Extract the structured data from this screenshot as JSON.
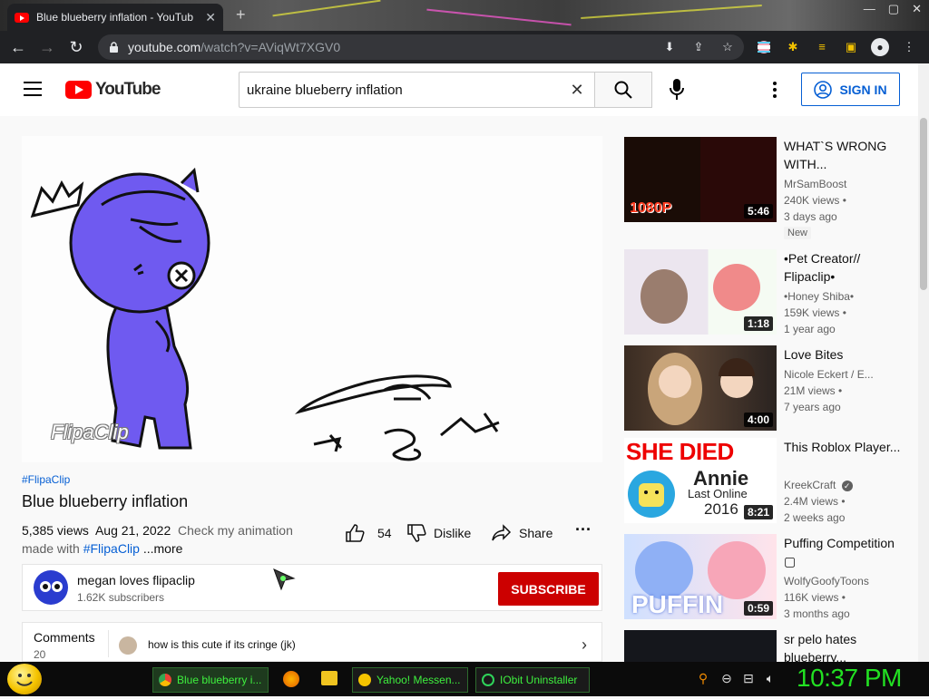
{
  "browser": {
    "tab_title": "Blue blueberry inflation - YouTub",
    "url_host": "youtube.com",
    "url_path": "/watch?v=AViqWt7XGV0"
  },
  "youtube": {
    "logo_text": "YouTube",
    "search_query": "ukraine blueberry inflation",
    "sign_in": "SIGN IN"
  },
  "video": {
    "hashtag": "#FlipaClip",
    "title": "Blue blueberry inflation",
    "views": "5,385 views",
    "date": "Aug 21, 2022",
    "description": "Check my animation",
    "desc_prefix": "made with",
    "desc_link": "#FlipaClip",
    "more": "...more",
    "likes": "54",
    "dislike": "Dislike",
    "share": "Share",
    "watermark": "FlipaClip"
  },
  "channel": {
    "name": "megan loves flipaclip",
    "subscribers": "1.62K subscribers",
    "subscribe": "SUBSCRIBE"
  },
  "comments": {
    "title": "Comments",
    "count": "20",
    "first": "how is this cute if its cringe (jk)"
  },
  "recommendations": [
    {
      "title": "WHAT`S WRONG WITH...",
      "channel": "MrSamBoost",
      "views": "240K views •",
      "age": "3 days ago",
      "badge": "New",
      "duration": "5:46",
      "thumb_text": "1080P"
    },
    {
      "title": "•Pet Creator// Flipaclip•",
      "channel": "•Honey Shiba•",
      "views": "159K views •",
      "age": "1 year ago",
      "duration": "1:18"
    },
    {
      "title": "Love Bites",
      "channel": "Nicole Eckert / E...",
      "views": "21M views •",
      "age": "7 years ago",
      "duration": "4:00"
    },
    {
      "title": "This Roblox Player...",
      "channel": "KreekCraft",
      "views": "2.4M views •",
      "age": "2 weeks ago",
      "duration": "8:21",
      "thumb_head": "SHE DIED",
      "thumb_name": "Annie",
      "thumb_sub": "Last Online",
      "thumb_year": "2016"
    },
    {
      "title": "Puffing Competition ▢",
      "channel": "WolfyGoofyToons",
      "views": "116K views •",
      "age": "3 months ago",
      "duration": "0:59",
      "thumb_text": "PUFFIN"
    },
    {
      "title": "sr pelo hates blueberry...",
      "channel": "",
      "views": "",
      "age": "",
      "duration": ""
    }
  ],
  "taskbar": {
    "tasks": [
      "Blue blueberry i...",
      "Yahoo! Messen...",
      "IObit Uninstaller"
    ],
    "clock": "10:37 PM"
  }
}
